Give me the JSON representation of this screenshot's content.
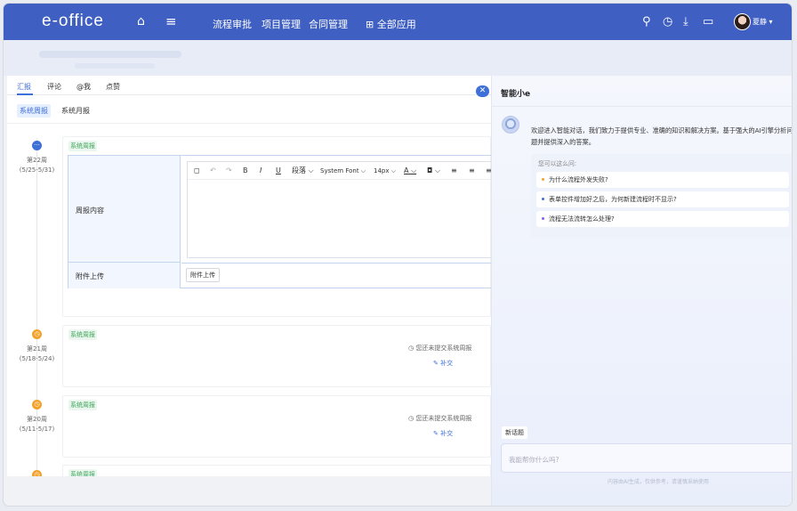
{
  "topbar": {
    "logo": "e-office",
    "nav": [
      "流程审批",
      "项目管理",
      "合同管理"
    ],
    "all_apps": "全部应用",
    "all_apps_icon": "⊞",
    "user": "夏静",
    "user_caret": "▾",
    "icons": {
      "home": "⌂",
      "menu": "≡",
      "search": "⚲",
      "clock": "◷",
      "download": "⤓",
      "document": "▭"
    }
  },
  "tabs": [
    "汇报",
    "评论",
    "@我",
    "点赞"
  ],
  "subtabs": [
    "系统周报",
    "系统月报"
  ],
  "form": {
    "content_label": "周报内容",
    "upload_label": "附件上传",
    "upload_button": "附件上传"
  },
  "toolbar": {
    "undo": "↶",
    "redo": "↷",
    "bold": "B",
    "italic": "I",
    "underline": "U",
    "paragraph": "段落 ⌵",
    "font": "System Font ⌵",
    "size": "14px ⌵",
    "color": "A ⌵",
    "highlight": "◘ ⌵"
  },
  "weeks": [
    {
      "icon": "···",
      "week": "第22周",
      "range": "(5/25-5/31)",
      "tag": "系统周报"
    },
    {
      "icon": "◷",
      "week": "第21周",
      "range": "(5/18-5/24)",
      "tag": "系统周报",
      "status": "您还未提交系统周报",
      "action": "补交"
    },
    {
      "icon": "◷",
      "week": "第20周",
      "range": "(5/11-5/17)",
      "tag": "系统周报",
      "status": "您还未提交系统周报",
      "action": "补交"
    },
    {
      "icon": "◷",
      "tag": "系统周报"
    }
  ],
  "status_icon": "◷",
  "action_icon": "✎",
  "ai": {
    "title": "智能小e",
    "close": "✕",
    "welcome": "欢迎进入智能对话，我们致力于提供专业、准确的知识和解决方案。基于强大的AI引擎分析问题并提供深入的答案。",
    "hint": "您可以这么问:",
    "suggestions": [
      {
        "text": "为什么流程外发失败?",
        "color": "#f2a22b"
      },
      {
        "text": "表单控件增加好之后，为何新建流程时不显示?",
        "color": "#3f6fd8"
      },
      {
        "text": "流程无法流转怎么处理?",
        "color": "#8b5cf6"
      }
    ],
    "new_topic": "新话题",
    "input_placeholder": "我能帮你什么吗?",
    "footer": "内容由AI生成，仅供参考，请谨慎采纳使用"
  }
}
